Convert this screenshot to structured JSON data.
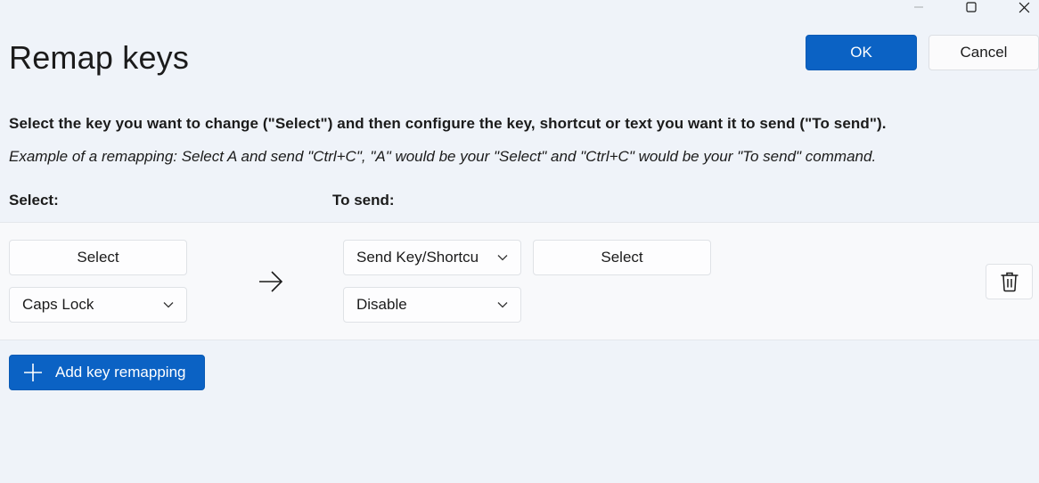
{
  "window": {
    "controls": {
      "minimize_icon": "minimize-icon",
      "maximize_icon": "maximize-icon",
      "close_icon": "close-icon"
    }
  },
  "header": {
    "title": "Remap keys",
    "ok_label": "OK",
    "cancel_label": "Cancel"
  },
  "instructions": {
    "main": "Select the key you want to change (\"Select\") and then configure the key, shortcut or text you want it to send (\"To send\").",
    "example": "Example of a remapping: Select A and send \"Ctrl+C\", \"A\" would be your \"Select\" and \"Ctrl+C\" would be your \"To send\" command."
  },
  "columns": {
    "select_header": "Select:",
    "send_header": "To send:"
  },
  "remappings": [
    {
      "select_button_label": "Select",
      "select_key_value": "Caps Lock",
      "send_type_value": "Send Key/Shortcu",
      "send_select_button_label": "Select",
      "send_key_value": "Disable"
    }
  ],
  "footer": {
    "add_label": "Add key remapping"
  },
  "colors": {
    "accent": "#0b62c4",
    "background": "#eff3f9",
    "row_background": "#f8f9fb"
  }
}
